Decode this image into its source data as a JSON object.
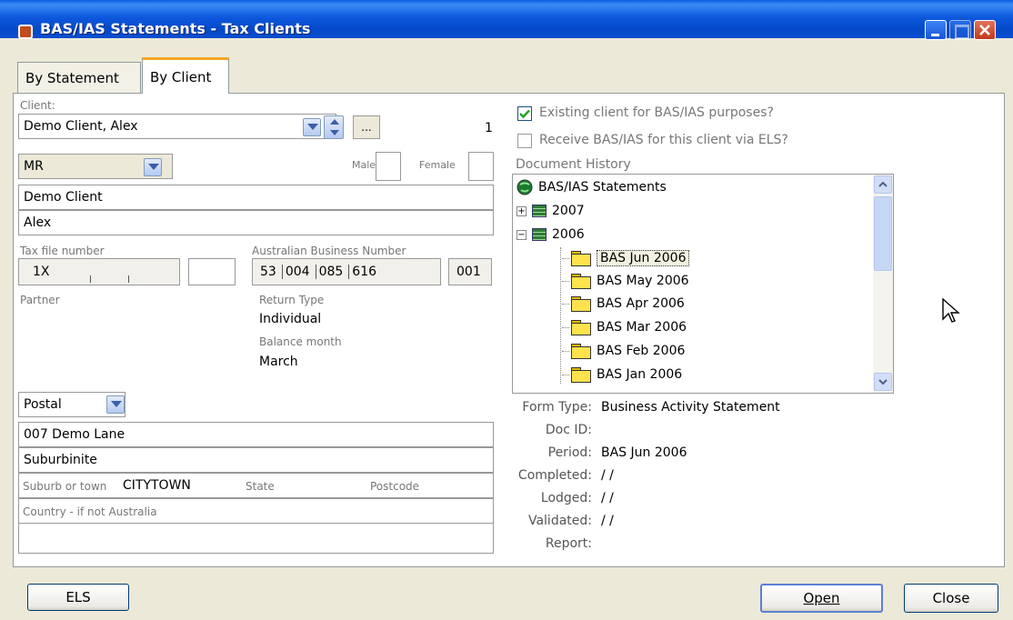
{
  "window": {
    "title": "BAS/IAS Statements - Tax Clients",
    "icon": "app-icon"
  },
  "tabs": [
    {
      "label": "By Statement",
      "selected": false
    },
    {
      "label": "By Client",
      "selected": true
    }
  ],
  "client": {
    "label": "Client:",
    "value": "Demo Client, Alex",
    "ellipsis": "...",
    "index": "1",
    "salutation": "MR",
    "male_label": "Male",
    "female_label": "Female",
    "surname": "Demo Client",
    "given_name": "Alex"
  },
  "tfn": {
    "label": "Tax file number",
    "value": "1X"
  },
  "abn": {
    "label": "Australian Business Number",
    "parts": [
      "53",
      "004",
      "085",
      "616"
    ],
    "branch": "001"
  },
  "partner": {
    "label": "Partner"
  },
  "return_type": {
    "label": "Return Type",
    "value": "Individual"
  },
  "balance_month": {
    "label": "Balance month",
    "value": "March"
  },
  "address": {
    "type": "Postal",
    "line1": "007 Demo Lane",
    "line2": "Suburbinite",
    "suburb_label": "Suburb or town",
    "suburb": "CITYTOWN",
    "state_label": "State",
    "postcode_label": "Postcode",
    "country_label": "Country - if not Australia"
  },
  "options": {
    "existing_client": {
      "label": "Existing client for BAS/IAS purposes?",
      "checked": true
    },
    "receive_els": {
      "label": "Receive BAS/IAS for this client via ELS?",
      "checked": false
    }
  },
  "document_history": {
    "label": "Document History",
    "root": "BAS/IAS Statements",
    "years": [
      {
        "label": "2007",
        "expanded": false
      },
      {
        "label": "2006",
        "expanded": true
      }
    ],
    "items": [
      "BAS Jun 2006",
      "BAS May 2006",
      "BAS Apr 2006",
      "BAS Mar 2006",
      "BAS Feb 2006",
      "BAS Jan 2006"
    ],
    "selected": "BAS Jun 2006"
  },
  "details": {
    "form_type_label": "Form Type:",
    "form_type": "Business Activity Statement",
    "doc_id_label": "Doc ID:",
    "doc_id": "",
    "period_label": "Period:",
    "period": "BAS Jun 2006",
    "completed_label": "Completed:",
    "completed": "/ /",
    "lodged_label": "Lodged:",
    "lodged": "/ /",
    "validated_label": "Validated:",
    "validated": "/ /",
    "report_label": "Report:",
    "report": ""
  },
  "buttons": {
    "els": "ELS",
    "open": "Open",
    "close": "Close"
  }
}
